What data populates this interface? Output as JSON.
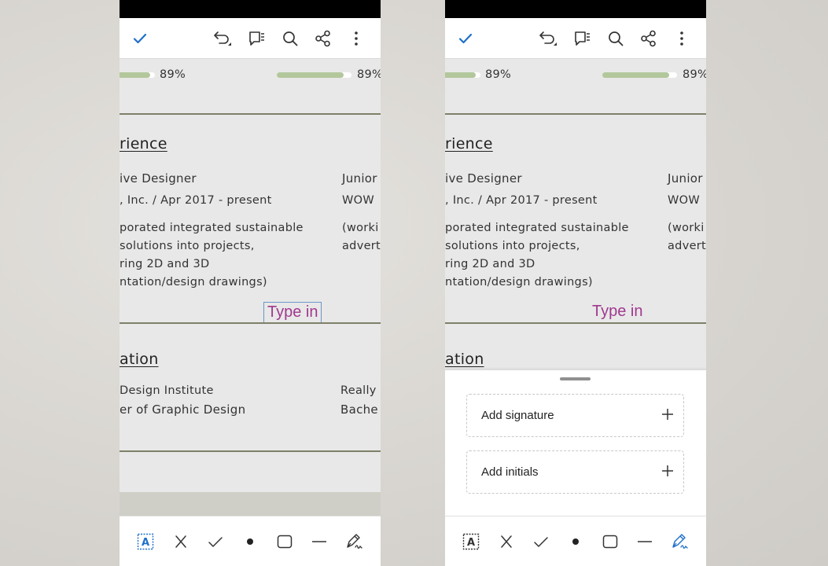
{
  "toolbar": {
    "done_icon": "checkmark-icon",
    "icons": [
      "undo-icon",
      "comments-icon",
      "search-icon",
      "share-icon",
      "more-vertical-icon"
    ]
  },
  "document": {
    "skills": [
      {
        "percent_label": "89%",
        "progress": 0.89
      },
      {
        "percent_label": "89%",
        "progress": 0.89
      }
    ],
    "experience_heading": "rience",
    "job1": {
      "title": "ive Designer",
      "company": ", Inc. / Apr 2017 - present",
      "desc": [
        "porated integrated sustainable",
        " solutions into projects,",
        "ring 2D and 3D",
        "ntation/design drawings)"
      ]
    },
    "job2": {
      "title": "Junior",
      "company": "WOW",
      "desc": [
        "(worki",
        "advert"
      ]
    },
    "type_in": "Type in",
    "education_heading": "ation",
    "edu1": {
      "school": "Design Institute",
      "degree": "er of Graphic Design"
    },
    "edu2": {
      "school": "Really",
      "degree": "Bache"
    }
  },
  "signature_sheet": {
    "items": [
      {
        "label": "Add signature",
        "icon": "plus-icon"
      },
      {
        "label": "Add initials",
        "icon": "plus-icon"
      }
    ]
  },
  "bottom_tools": [
    "text-field-icon",
    "cross-icon",
    "check-icon",
    "dot-icon",
    "rectangle-icon",
    "line-icon",
    "signature-pen-icon"
  ],
  "colors": {
    "accent": "#1f6fc9",
    "type_in_text": "#a0388f",
    "progress_fill": "#b3c79c",
    "divider": "#7e8068"
  }
}
